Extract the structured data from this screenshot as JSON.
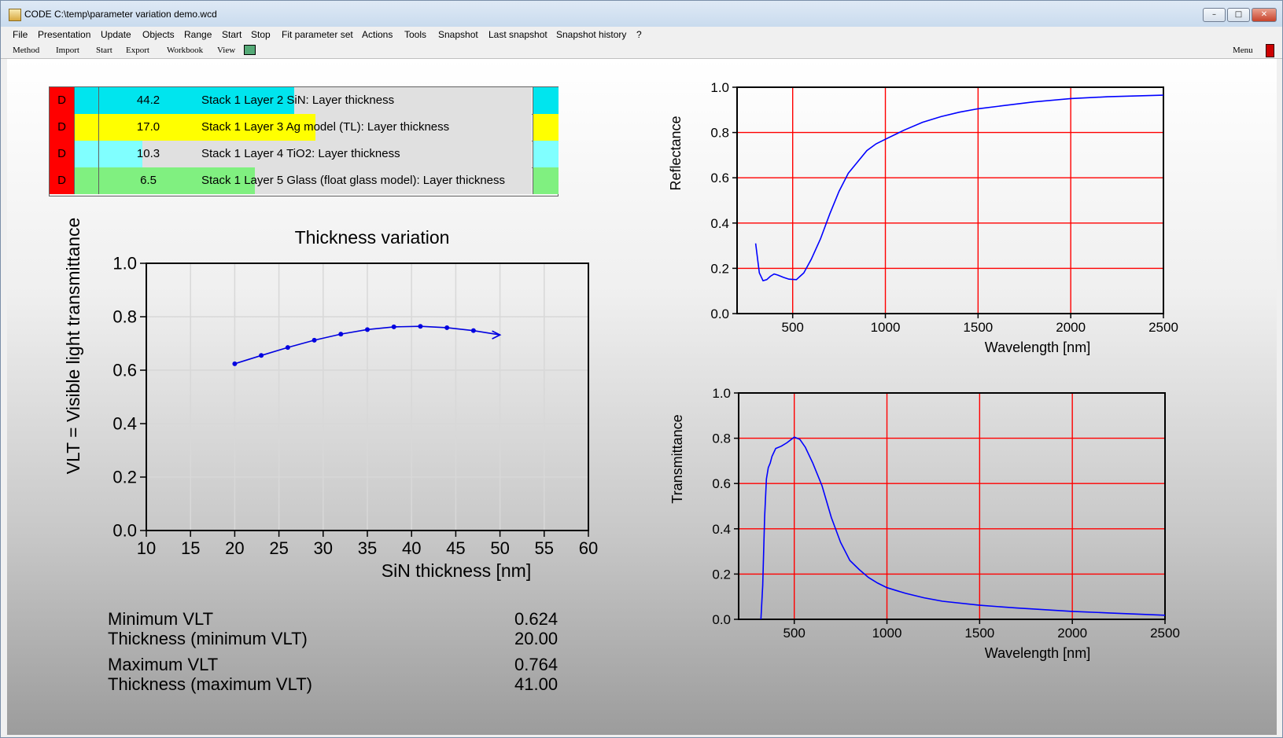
{
  "window": {
    "title": "CODE C:\\temp\\parameter variation demo.wcd"
  },
  "menu": [
    "File",
    "Presentation",
    "Update",
    "Objects",
    "Range",
    "Start",
    "Stop",
    "Fit parameter set",
    "Actions",
    "Tools",
    "Snapshot",
    "Last snapshot",
    "Snapshot history",
    "?"
  ],
  "toolbar": {
    "items": [
      "Method",
      "Import",
      "Start",
      "Export",
      "Workbook",
      "View"
    ],
    "menu_label": "Menu"
  },
  "parameters": [
    {
      "flag": "D",
      "value": "44.2",
      "label": "Stack 1 Layer  2 SiN: Layer thickness",
      "color": "#00e5ee",
      "fill": 0.45
    },
    {
      "flag": "D",
      "value": "17.0",
      "label": "Stack 1 Layer  3 Ag model (TL): Layer thickness",
      "color": "#ffff00",
      "fill": 0.5
    },
    {
      "flag": "D",
      "value": "10.3",
      "label": "Stack 1 Layer  4 TiO2: Layer thickness",
      "color": "#80ffff",
      "fill": 0.1
    },
    {
      "flag": "D",
      "value": "6.5",
      "label": "Stack 1 Layer  5 Glass (float glass model): Layer thickness",
      "color": "#80f080",
      "fill": 0.36
    }
  ],
  "stats": {
    "min_label": "Minimum VLT",
    "min_value": "0.624",
    "min_thick_label": "Thickness (minimum VLT)",
    "min_thick_value": "20.00",
    "max_label": "Maximum VLT",
    "max_value": "0.764",
    "max_thick_label": "Thickness (maximum VLT)",
    "max_thick_value": "41.00"
  },
  "chart_data": [
    {
      "type": "line",
      "title": "Thickness variation",
      "xlabel": "SiN thickness [nm]",
      "ylabel": "VLT = Visible light transmittance",
      "xlim": [
        10,
        60
      ],
      "ylim": [
        0.0,
        1.0
      ],
      "xticks": [
        "10",
        "15",
        "20",
        "25",
        "30",
        "35",
        "40",
        "45",
        "50",
        "55",
        "60"
      ],
      "yticks": [
        "0.0",
        "0.2",
        "0.4",
        "0.6",
        "0.8",
        "1.0"
      ],
      "grid": true,
      "color": "#0000e0",
      "x": [
        20,
        23,
        26,
        29,
        32,
        35,
        38,
        41,
        44,
        47,
        50
      ],
      "y": [
        0.624,
        0.655,
        0.685,
        0.712,
        0.735,
        0.752,
        0.762,
        0.764,
        0.759,
        0.748,
        0.732
      ]
    },
    {
      "type": "line",
      "title": "",
      "xlabel": "Wavelength [nm]",
      "ylabel": "Reflectance",
      "xlim": [
        200,
        2500
      ],
      "ylim": [
        0.0,
        1.0
      ],
      "xticks": [
        "500",
        "1000",
        "1500",
        "2000",
        "2500"
      ],
      "yticks": [
        "0.0",
        "0.2",
        "0.4",
        "0.6",
        "0.8",
        "1.0"
      ],
      "grid": true,
      "color": "#0000ff",
      "x": [
        300,
        320,
        340,
        360,
        380,
        400,
        420,
        450,
        480,
        520,
        560,
        600,
        650,
        700,
        750,
        800,
        850,
        900,
        950,
        1000,
        1100,
        1200,
        1300,
        1400,
        1500,
        1600,
        1800,
        2000,
        2200,
        2500
      ],
      "y": [
        0.31,
        0.18,
        0.145,
        0.15,
        0.165,
        0.175,
        0.17,
        0.16,
        0.152,
        0.15,
        0.18,
        0.24,
        0.33,
        0.44,
        0.54,
        0.62,
        0.67,
        0.72,
        0.75,
        0.77,
        0.81,
        0.845,
        0.87,
        0.89,
        0.905,
        0.915,
        0.935,
        0.95,
        0.958,
        0.965
      ]
    },
    {
      "type": "line",
      "title": "",
      "xlabel": "Wavelength [nm]",
      "ylabel": "Transmittance",
      "xlim": [
        200,
        2500
      ],
      "ylim": [
        0.0,
        1.0
      ],
      "xticks": [
        "500",
        "1000",
        "1500",
        "2000",
        "2500"
      ],
      "yticks": [
        "0.0",
        "0.2",
        "0.4",
        "0.6",
        "0.8",
        "1.0"
      ],
      "grid": true,
      "color": "#0000ff",
      "x": [
        320,
        330,
        340,
        350,
        360,
        370,
        380,
        400,
        430,
        460,
        500,
        530,
        560,
        600,
        650,
        700,
        750,
        800,
        850,
        900,
        950,
        1000,
        1100,
        1200,
        1300,
        1500,
        1700,
        2000,
        2200,
        2500
      ],
      "y": [
        0.0,
        0.15,
        0.45,
        0.62,
        0.67,
        0.69,
        0.72,
        0.755,
        0.765,
        0.78,
        0.805,
        0.795,
        0.76,
        0.69,
        0.59,
        0.45,
        0.34,
        0.26,
        0.22,
        0.185,
        0.16,
        0.14,
        0.115,
        0.095,
        0.08,
        0.062,
        0.05,
        0.035,
        0.028,
        0.018
      ]
    }
  ]
}
